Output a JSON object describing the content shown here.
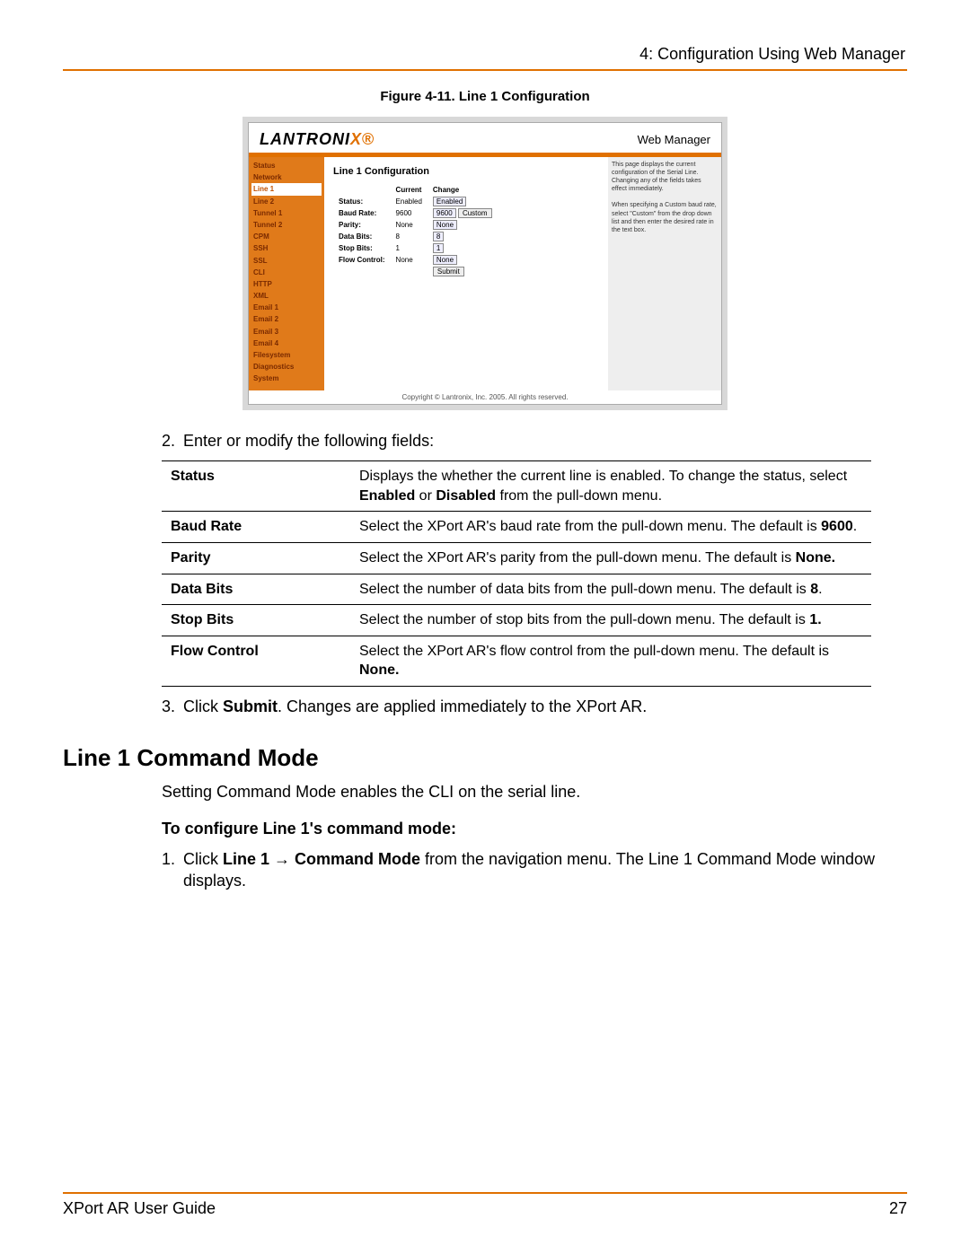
{
  "header": {
    "chapter": "4: Configuration Using Web Manager"
  },
  "figure": {
    "caption": "Figure 4-11. Line 1 Configuration"
  },
  "shot": {
    "logo_head": "LANTRONI",
    "logo_tail": "X",
    "web_manager": "Web Manager",
    "sidebar_items": [
      "Status",
      "Network",
      "Line 1",
      "Line 2",
      "Tunnel 1",
      "Tunnel 2",
      "CPM",
      "SSH",
      "SSL",
      "CLI",
      "HTTP",
      "XML",
      "Email 1",
      "Email 2",
      "Email 3",
      "Email 4",
      "Filesystem",
      "Diagnostics",
      "System"
    ],
    "panel_title": "Line 1 Configuration",
    "col_current": "Current",
    "col_change": "Change",
    "rows": {
      "status": {
        "label": "Status:",
        "current": "Enabled",
        "change": "Enabled"
      },
      "baud": {
        "label": "Baud Rate:",
        "current": "9600",
        "change": "9600",
        "custom": "Custom"
      },
      "parity": {
        "label": "Parity:",
        "current": "None",
        "change": "None"
      },
      "databits": {
        "label": "Data Bits:",
        "current": "8",
        "change": "8"
      },
      "stopbits": {
        "label": "Stop Bits:",
        "current": "1",
        "change": "1"
      },
      "flow": {
        "label": "Flow Control:",
        "current": "None",
        "change": "None"
      }
    },
    "submit": "Submit",
    "help1": "This page displays the current configuration of the Serial Line. Changing any of the fields takes effect immediately.",
    "help2": "When specifying a Custom baud rate, select \"Custom\" from the drop down list and then enter the desired rate in the text box.",
    "copyright": "Copyright © Lantronix, Inc. 2005. All rights reserved."
  },
  "step2": "Enter or modify the following fields:",
  "fields": [
    {
      "name": "Status",
      "desc_a": "Displays the whether the current line is enabled. To change the status, select ",
      "b1": "Enabled",
      "mid": " or ",
      "b2": "Disabled",
      "desc_b": " from the pull-down menu."
    },
    {
      "name": "Baud Rate",
      "desc_a": "Select the XPort AR's baud rate from the pull-down menu. The default is ",
      "b1": "9600",
      "mid": "",
      "b2": "",
      "desc_b": "."
    },
    {
      "name": "Parity",
      "desc_a": "Select the XPort AR's parity from the pull-down menu. The default is ",
      "b1": "None.",
      "mid": "",
      "b2": "",
      "desc_b": ""
    },
    {
      "name": "Data Bits",
      "desc_a": "Select the number of data bits from the pull-down menu. The default is ",
      "b1": "8",
      "mid": "",
      "b2": "",
      "desc_b": "."
    },
    {
      "name": "Stop Bits",
      "desc_a": "Select the number of stop bits from the pull-down menu. The default is ",
      "b1": "1.",
      "mid": "",
      "b2": "",
      "desc_b": ""
    },
    {
      "name": "Flow Control",
      "desc_a": "Select the XPort AR's flow control from the pull-down menu. The default is ",
      "b1": "None.",
      "mid": "",
      "b2": "",
      "desc_b": ""
    }
  ],
  "step3_a": "Click ",
  "step3_b": "Submit",
  "step3_c": ". Changes are applied immediately to the XPort AR.",
  "section_title": "Line 1 Command Mode",
  "section_intro": "Setting Command Mode enables the CLI on the serial line.",
  "section_sub": "To configure Line 1's command mode:",
  "s1_a": "Click ",
  "s1_b": "Line 1 ",
  "s1_arrow": "→",
  "s1_c": " Command Mode",
  "s1_d": " from the navigation menu. The Line 1 Command Mode window displays.",
  "footer": {
    "guide": "XPort AR User Guide",
    "page": "27"
  }
}
